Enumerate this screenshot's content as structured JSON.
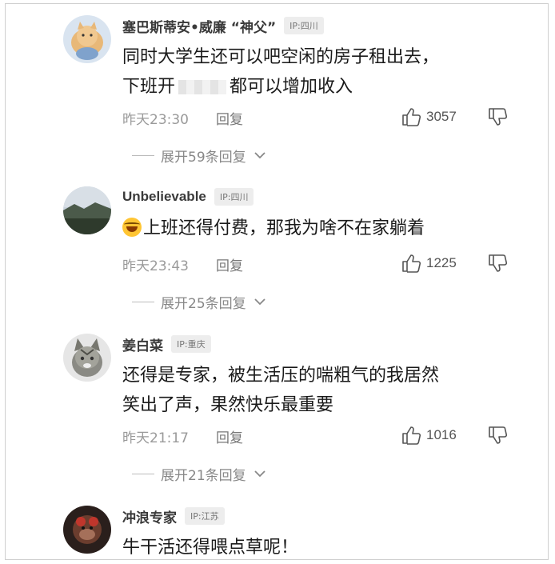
{
  "comments": [
    {
      "username": "塞巴斯蒂安•威廉 “神父”",
      "ip": "IP:四川",
      "lines": [
        "同时大学生还可以吧空闲的房子租出去，",
        "下班开",
        "都可以增加收入"
      ],
      "time": "昨天23:30",
      "reply": "回复",
      "likes": "3057",
      "expand": "展开59条回复"
    },
    {
      "username": "Unbelievable",
      "ip": "IP:四川",
      "lines": [
        "上班还得付费，那我为啥不在家躺着"
      ],
      "time": "昨天23:43",
      "reply": "回复",
      "likes": "1225",
      "expand": "展开25条回复"
    },
    {
      "username": "姜白菜",
      "ip": "IP:重庆",
      "lines": [
        "还得是专家，被生活压的喘粗气的我居然",
        "笑出了声，果然快乐最重要"
      ],
      "time": "昨天21:17",
      "reply": "回复",
      "likes": "1016",
      "expand": "展开21条回复"
    },
    {
      "username": "冲浪专家",
      "ip": "IP:江苏",
      "lines": [
        "牛干活还得喂点草呢！"
      ]
    }
  ]
}
